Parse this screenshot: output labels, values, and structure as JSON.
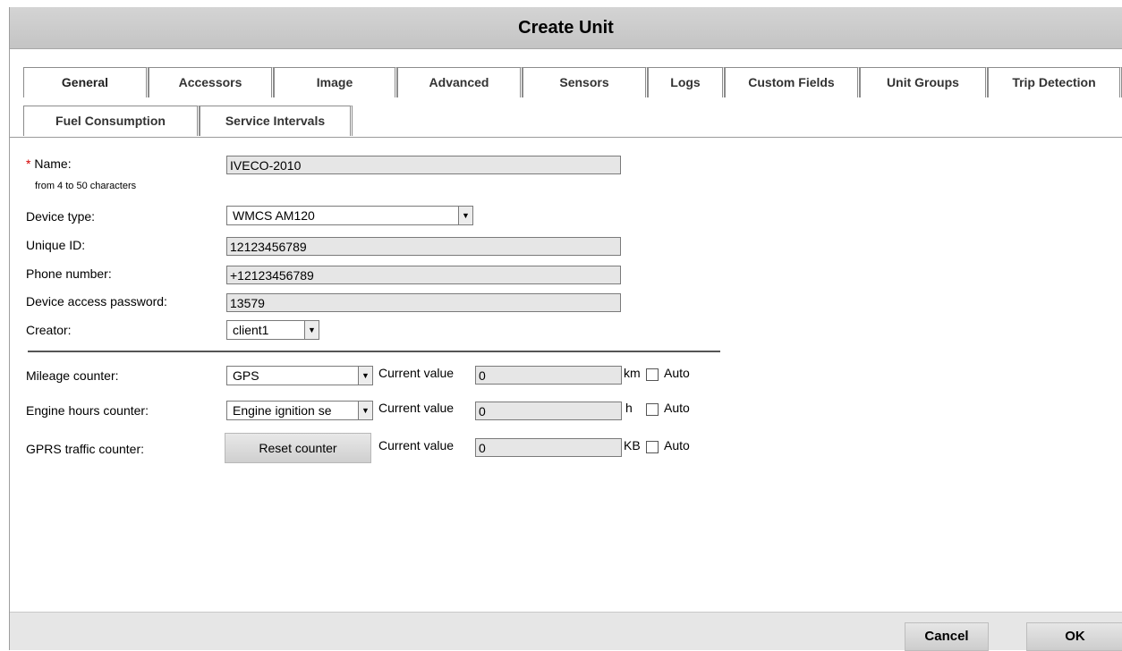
{
  "dialog": {
    "title": "Create Unit"
  },
  "tabs": [
    {
      "label": "General",
      "active": true
    },
    {
      "label": "Accessors"
    },
    {
      "label": "Image"
    },
    {
      "label": "Advanced"
    },
    {
      "label": "Sensors"
    },
    {
      "label": "Logs"
    },
    {
      "label": "Custom Fields"
    },
    {
      "label": "Unit Groups"
    },
    {
      "label": "Trip Detection"
    },
    {
      "label": "Fuel Consumption"
    },
    {
      "label": "Service Intervals"
    }
  ],
  "general": {
    "required_mark": "*",
    "name_label": "Name:",
    "name_value": "IVECO-2010",
    "name_hint": "from 4 to 50 characters",
    "device_type_label": "Device type:",
    "device_type_value": "WMCS AM120",
    "unique_id_label": "Unique ID:",
    "unique_id_value": "12123456789",
    "phone_label": "Phone number:",
    "phone_value": "+12123456789",
    "password_label": "Device access password:",
    "password_value": "13579",
    "creator_label": "Creator:",
    "creator_value": "client1"
  },
  "counters": {
    "current_value_label": "Current value",
    "auto_label": "Auto",
    "mileage": {
      "label": "Mileage counter:",
      "type": "GPS",
      "value": "0",
      "unit": "km",
      "auto": false
    },
    "engine_hours": {
      "label": "Engine hours counter:",
      "type": "Engine ignition se",
      "value": "0",
      "unit": "h",
      "auto": false
    },
    "gprs": {
      "label": "GPRS traffic counter:",
      "reset_label": "Reset counter",
      "value": "0",
      "unit": "KB",
      "auto": false
    }
  },
  "footer": {
    "cancel_label": "Cancel",
    "ok_label": "OK"
  },
  "icons": {
    "dropdown": "chevron-down-icon",
    "checkbox": "checkbox-icon"
  }
}
